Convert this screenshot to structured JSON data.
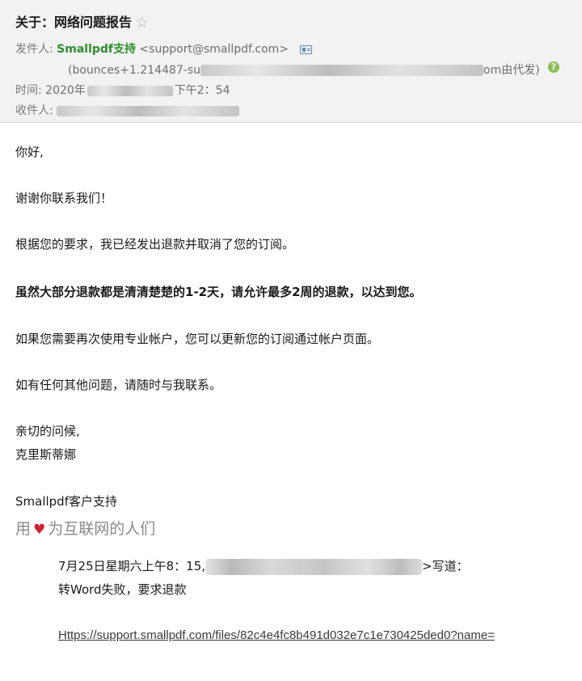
{
  "header": {
    "subject": "关于：网络问题报告",
    "sender_label": "发件人:",
    "sender_name": "Smallpdf支持",
    "sender_email": "<support@smallpdf.com>",
    "bounce_prefix": "(bounces+1.214487-su",
    "bounce_suffix": "om由代发)",
    "time_label": "时间:",
    "time_value": "2020年",
    "time_value2": "下午2：54",
    "recipient_label": "收件人:"
  },
  "body": {
    "greeting": "你好,",
    "thanks": "谢谢你联系我们！",
    "refund_issued": "根据您的要求，我已经发出退款并取消了您的订阅。",
    "refund_time": "虽然大部分退款都是清清楚楚的1-2天，请允许最多2周的退款，以达到您。",
    "renew": "如果您需要再次使用专业帐户，您可以更新您的订阅通过帐户页面。",
    "questions": "如有任何其他问题，请随时与我联系。",
    "regards": "亲切的问候,",
    "signature_name": "克里斯蒂娜",
    "signature_team": "Smallpdf客户支持",
    "love_prefix": "用",
    "love_suffix": "为互联网的人们"
  },
  "quote": {
    "date": "7月25日星期六上午8：15,",
    "wrote": ">写道：",
    "message": "转Word失败，要求退款",
    "link": "Https://support.smallpdf.com/files/82c4e4fc8b491d032e7c1e730425ded0?name="
  },
  "colors": {
    "sender_green": "#2f8f2f",
    "heart_red": "#d0202e",
    "header_bg": "#f2f2f2"
  }
}
